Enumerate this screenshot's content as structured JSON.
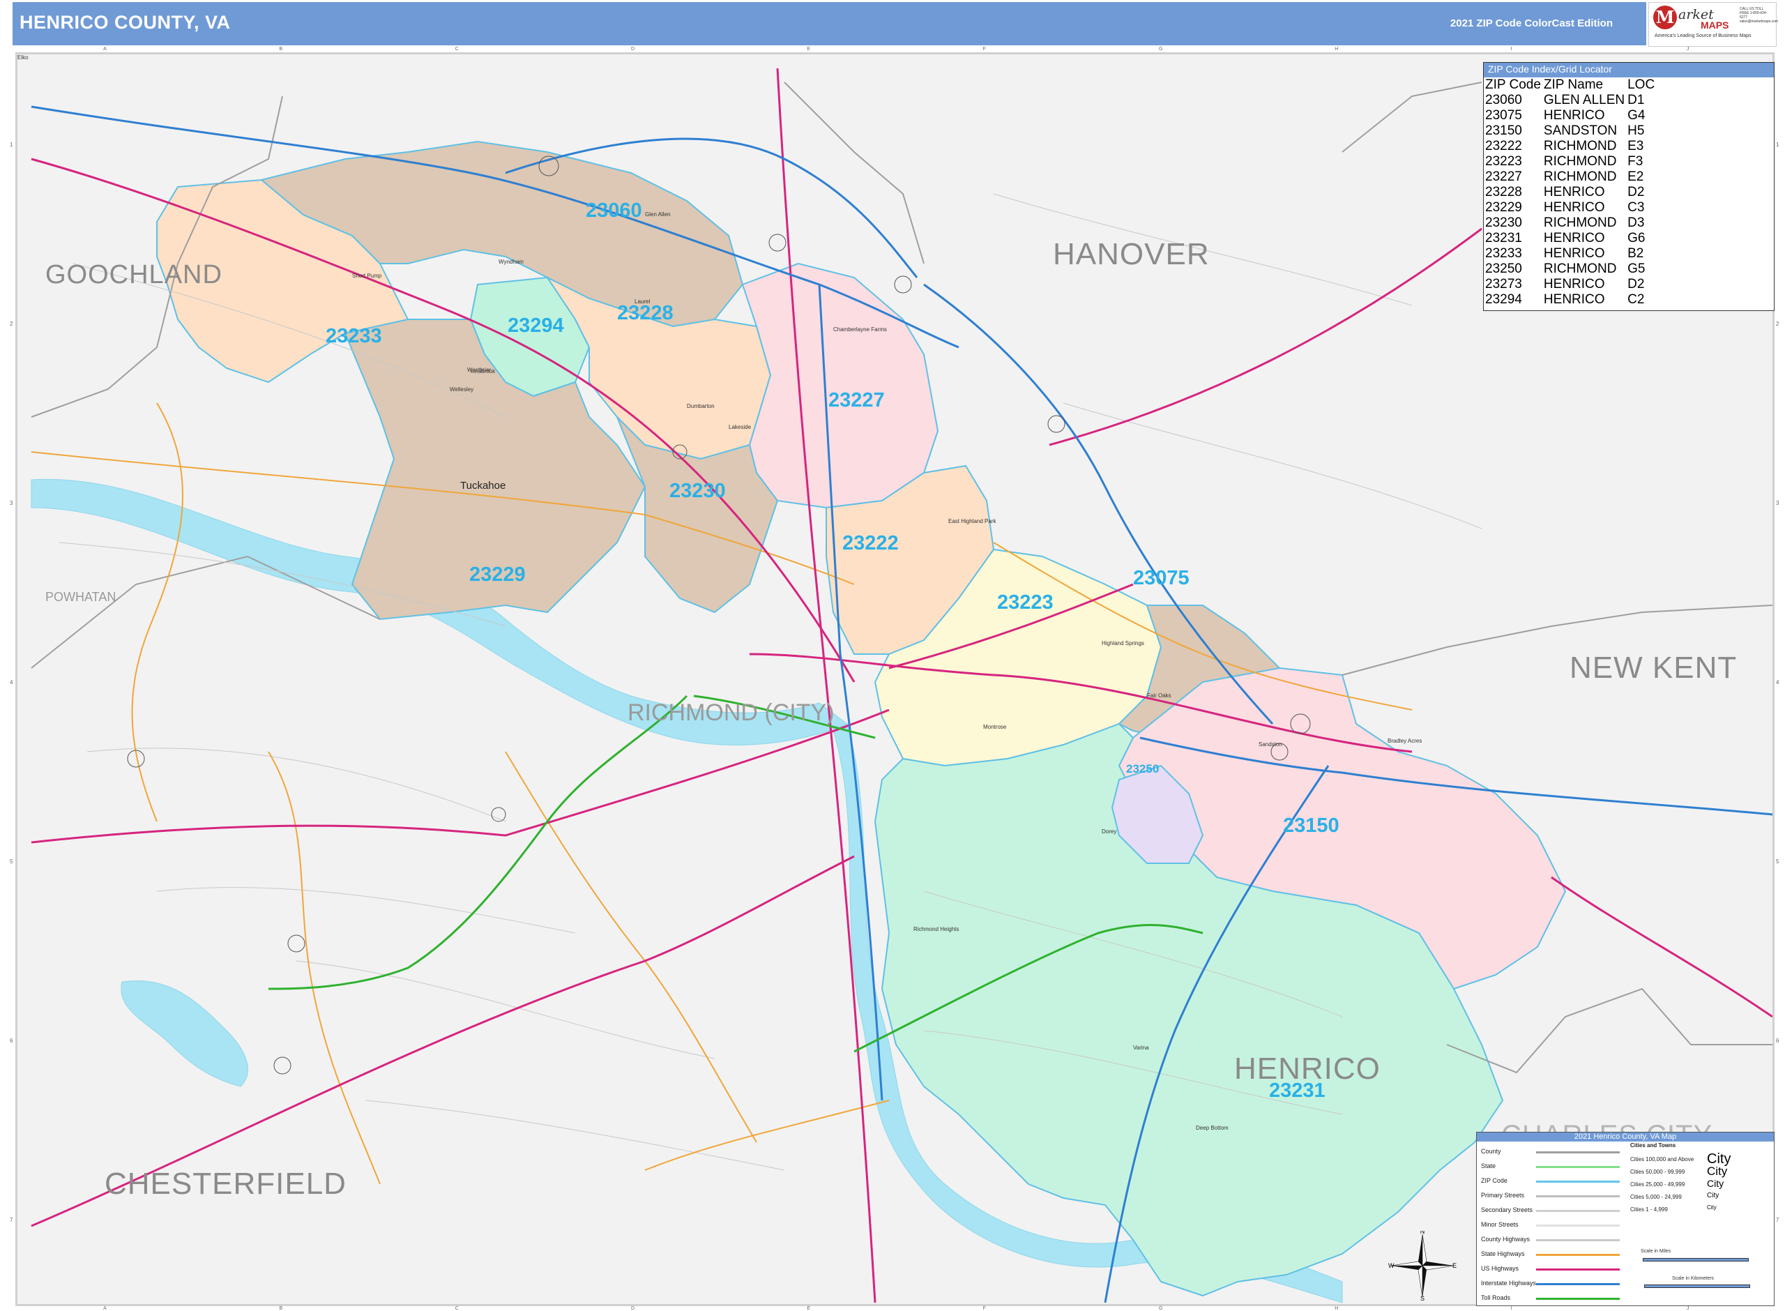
{
  "header": {
    "title": "HENRICO COUNTY, VA",
    "edition": "2021 ZIP Code ColorCast Edition",
    "logo_mark": "M",
    "logo_name": "arket",
    "logo_maps": "MAPS",
    "logo_tagline": "America's Leading Source of Business Maps",
    "logo_contact": "CALL US TOLL FREE 1-800-424-6277 sales@marketmaps.com"
  },
  "grid": {
    "columns": [
      "A",
      "B",
      "C",
      "D",
      "E",
      "F",
      "G",
      "H",
      "I",
      "J"
    ],
    "rows": [
      "1",
      "2",
      "3",
      "4",
      "5",
      "6",
      "7"
    ]
  },
  "counties": {
    "goochland": "GOOCHLAND",
    "hanover": "HANOVER",
    "new_kent": "NEW KENT",
    "chesterfield": "CHESTERFIELD",
    "henrico": "HENRICO",
    "charles_city": "CHARLES CITY",
    "powhatan": "POWHATAN",
    "richmond_city": "RICHMOND (CITY)"
  },
  "zip_labels": {
    "z23060": "23060",
    "z23228": "23228",
    "z23294": "23294",
    "z23233": "23233",
    "z23227": "23227",
    "z23230": "23230",
    "z23222": "23222",
    "z23229": "23229",
    "z23075": "23075",
    "z23223": "23223",
    "z23250": "23250",
    "z23150": "23150",
    "z23231": "23231"
  },
  "places": {
    "tuckahoe": "Tuckahoe",
    "glen_allen": "Glen Allen",
    "laurel": "Laurel",
    "lakeside": "Lakeside",
    "highland_springs": "Highland Springs",
    "sandston": "Sandston",
    "varina": "Varina",
    "short_pump": "Short Pump",
    "wyndham": "Wyndham",
    "innsbrook": "Innsbrook",
    "montrose": "Montrose",
    "dumbarton": "Dumbarton",
    "east_highland_park": "East Highland Park",
    "chamberlayne": "Chamberlayne Farms",
    "richmond_heights": "Richmond Heights",
    "deep_bottom": "Deep Bottom",
    "fair_oaks": "Fair Oaks",
    "elko": "Elko",
    "bradley_acres": "Bradley Acres",
    "dorey": "Dorey",
    "west_end": "Westbriar",
    "wellesley": "Wellesley"
  },
  "zip_index": {
    "heading": "ZIP Code Index/Grid Locator",
    "columns": [
      "ZIP Code",
      "ZIP Name",
      "LOC"
    ],
    "rows": [
      [
        "23060",
        "GLEN ALLEN",
        "D1"
      ],
      [
        "23075",
        "HENRICO",
        "G4"
      ],
      [
        "23150",
        "SANDSTON",
        "H5"
      ],
      [
        "23222",
        "RICHMOND",
        "E3"
      ],
      [
        "23223",
        "RICHMOND",
        "F3"
      ],
      [
        "23227",
        "RICHMOND",
        "E2"
      ],
      [
        "23228",
        "HENRICO",
        "D2"
      ],
      [
        "23229",
        "HENRICO",
        "C3"
      ],
      [
        "23230",
        "RICHMOND",
        "D3"
      ],
      [
        "23231",
        "HENRICO",
        "G6"
      ],
      [
        "23233",
        "HENRICO",
        "B2"
      ],
      [
        "23250",
        "RICHMOND",
        "G5"
      ],
      [
        "23273",
        "HENRICO",
        "D2"
      ],
      [
        "23294",
        "HENRICO",
        "C2"
      ]
    ]
  },
  "legend": {
    "heading": "2021 Henrico County, VA Map",
    "cities_heading": "Cities and Towns",
    "line_items": [
      {
        "label": "County",
        "color": "#9e9e9e"
      },
      {
        "label": "State",
        "color": "#7ee08a"
      },
      {
        "label": "ZIP Code",
        "color": "#62c6ea"
      },
      {
        "label": "Primary Streets",
        "color": "#bdbdbd"
      },
      {
        "label": "Secondary Streets",
        "color": "#cfcfcf"
      },
      {
        "label": "Minor Streets",
        "color": "#e0e0e0"
      },
      {
        "label": "County Highways",
        "color": "#c9c9c9"
      },
      {
        "label": "State Highways",
        "color": "#f0a63a"
      },
      {
        "label": "US Highways",
        "color": "#d6247e"
      },
      {
        "label": "Interstate Highways",
        "color": "#2e7fd1"
      },
      {
        "label": "Toll Roads",
        "color": "#2fb12f"
      }
    ],
    "city_items": [
      {
        "label": "Cities 100,000 and Above",
        "sample": "City"
      },
      {
        "label": "Cities 50,000 - 99,999",
        "sample": "City"
      },
      {
        "label": "Cities 25,000 - 49,999",
        "sample": "City"
      },
      {
        "label": "Cities 5,000 - 24,999",
        "sample": "City"
      },
      {
        "label": "Cities 1 - 4,999",
        "sample": "City"
      }
    ],
    "scale_miles": "Scale in Miles",
    "scale_km": "Scale in Kilometers"
  },
  "compass": {
    "n": "N",
    "s": "S",
    "e": "E",
    "w": "W"
  },
  "colors": {
    "header": "#6f9ad6",
    "zip_label": "#2ab0e6",
    "zone_tan": "#dcc8b4",
    "zone_peach": "#fde0c6",
    "zone_pink": "#fbdde2",
    "zone_mint": "#bff3dd",
    "zone_yellow": "#fdf8d6",
    "zone_lavender": "#e6dcf6",
    "zone_teal": "#c6f3df",
    "water": "#a8e4f4"
  }
}
